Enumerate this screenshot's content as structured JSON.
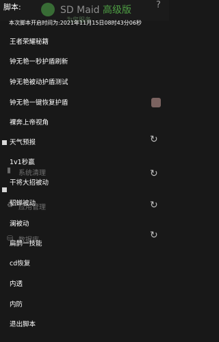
{
  "background_app": {
    "title": "SD Maid",
    "title_pro": "高级版",
    "subtitle": "为您服务",
    "help_icon": "question-mark",
    "sections": [
      {
        "label": "系统清理"
      },
      {
        "label": "应用管理"
      },
      {
        "label": "数据库"
      }
    ]
  },
  "script_menu": {
    "header": "脚本:",
    "start_time": "本次脚本开启时间为:2021年11月15日08时43分06秒",
    "items": [
      "王者荣耀秘籍",
      "钟无艳一秒护盾刷新",
      "钟无艳被动护盾测试",
      "钟无艳一键恢复护盾",
      "裸奔上帝视角",
      "天气预报",
      "1v1秒赢",
      "干将大招被动",
      "貂蝉被动",
      "澜被动",
      "扁鹊一技能",
      "cd恢复",
      "内透",
      "内防",
      "退出脚本"
    ]
  }
}
